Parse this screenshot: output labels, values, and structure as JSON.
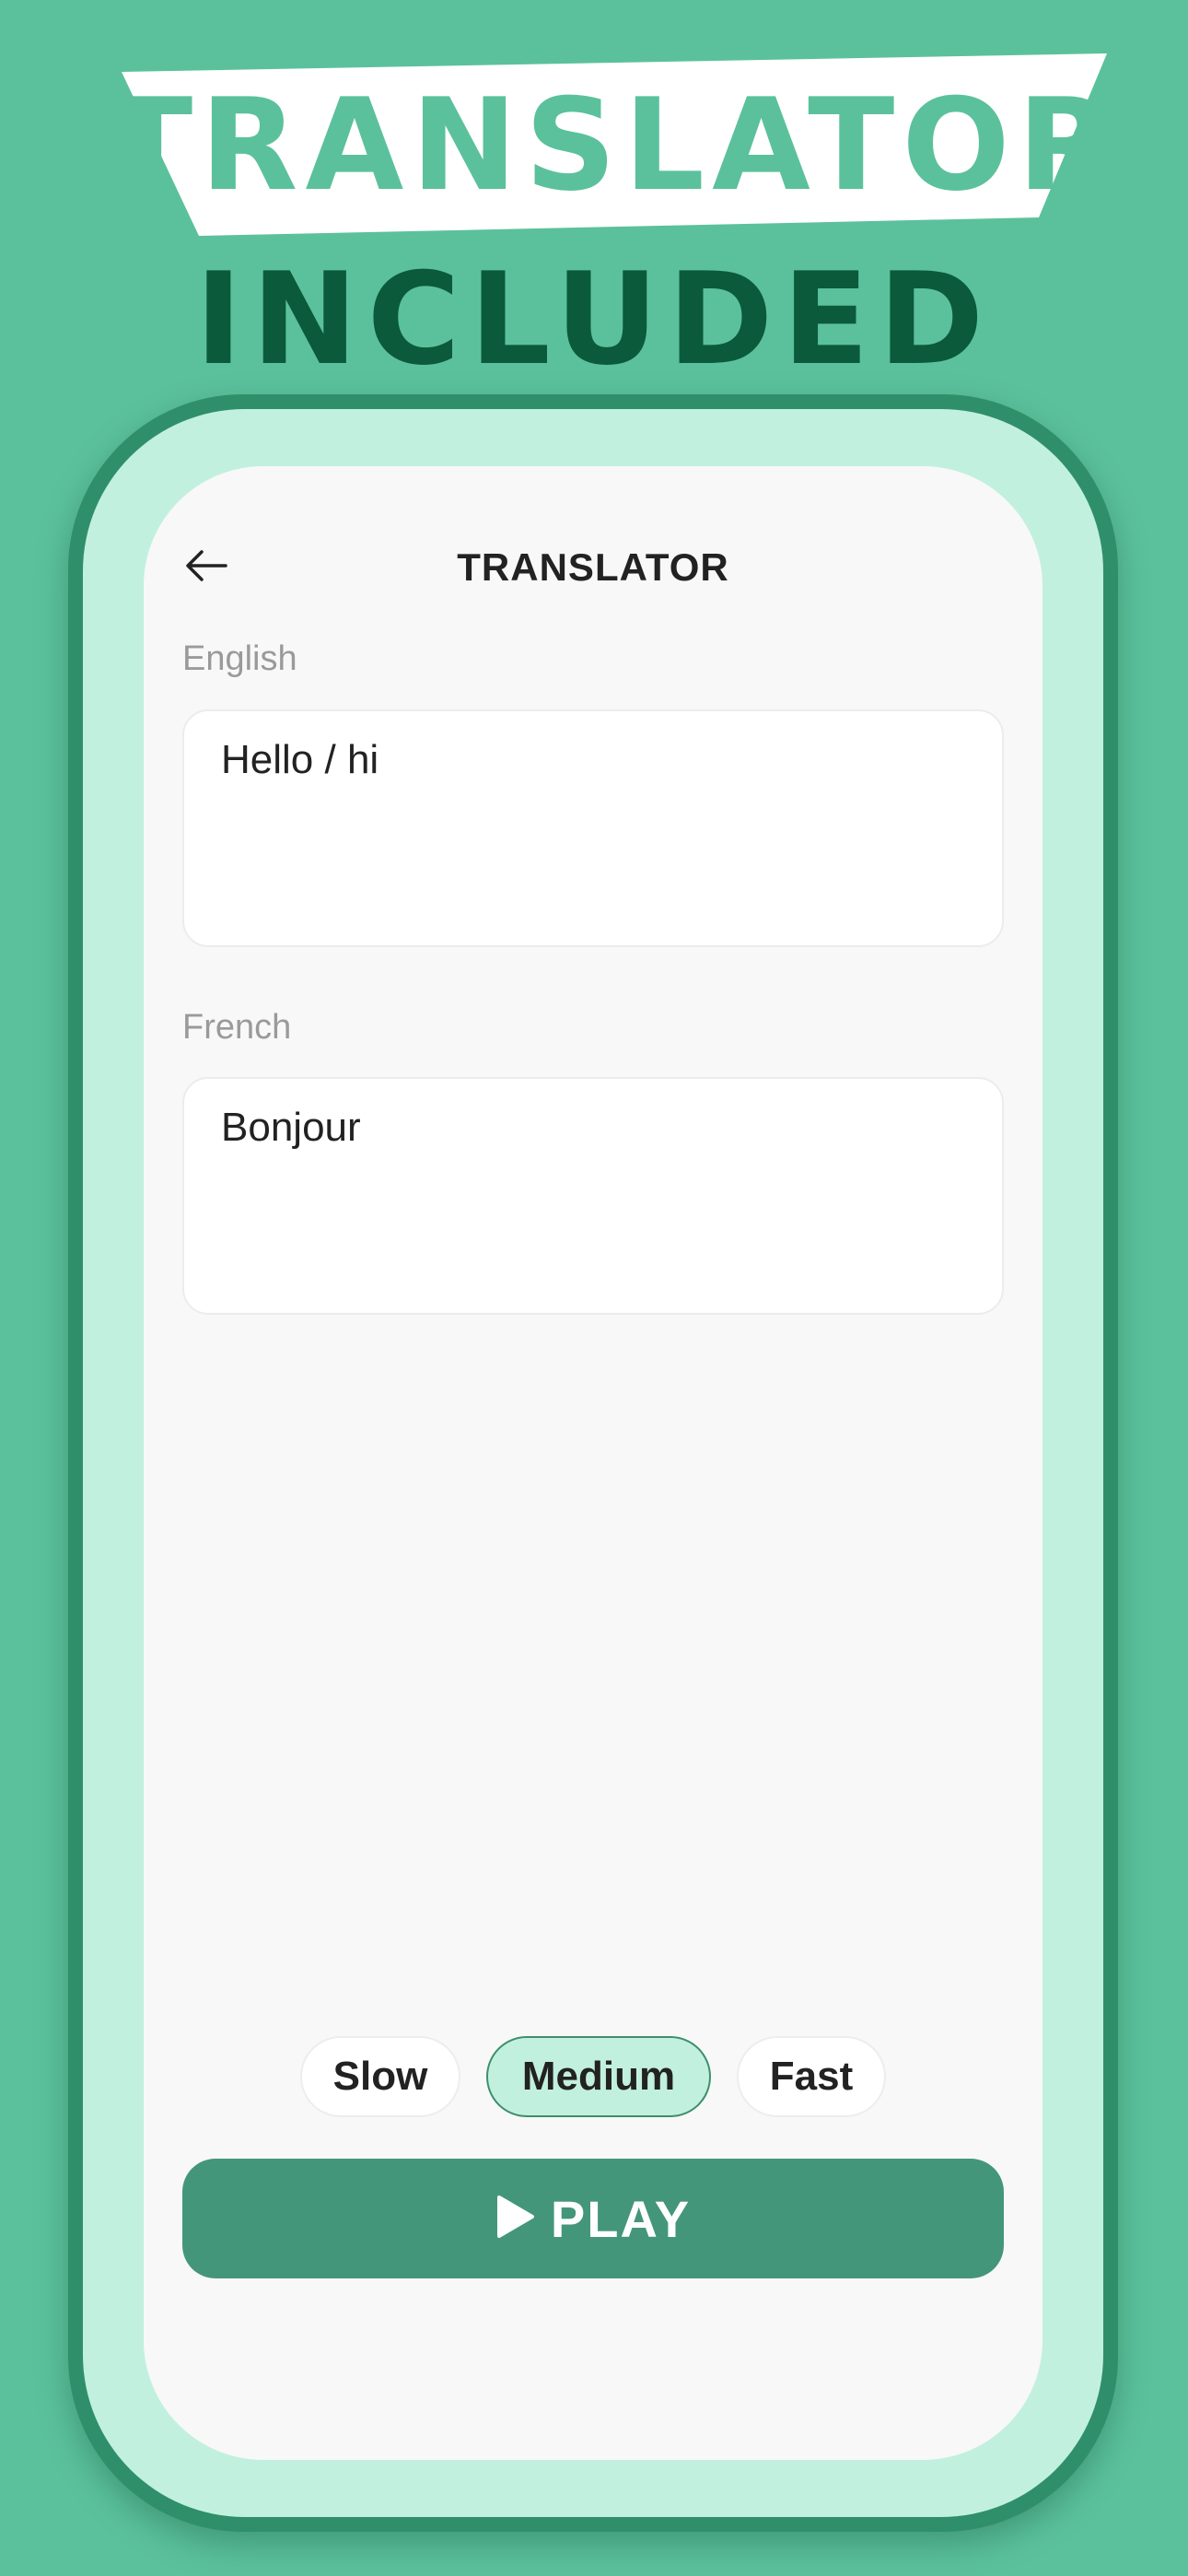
{
  "promo": {
    "title": "TRANSLATOR",
    "subtitle": "INCLUDED"
  },
  "app": {
    "header": {
      "title": "TRANSLATOR",
      "back_icon": "arrow-left-icon"
    },
    "source": {
      "language": "English",
      "text": "Hello / hi"
    },
    "target": {
      "language": "French",
      "text": "Bonjour"
    },
    "speed": {
      "options": [
        "Slow",
        "Medium",
        "Fast"
      ],
      "selected": "Medium"
    },
    "play_button": {
      "label": "PLAY",
      "icon": "play-icon"
    }
  },
  "colors": {
    "background": "#5bc19c",
    "accent_dark": "#0b5a3b",
    "frame": "#2f8f6a",
    "bezel": "#c2f0df",
    "play": "#44967a"
  }
}
